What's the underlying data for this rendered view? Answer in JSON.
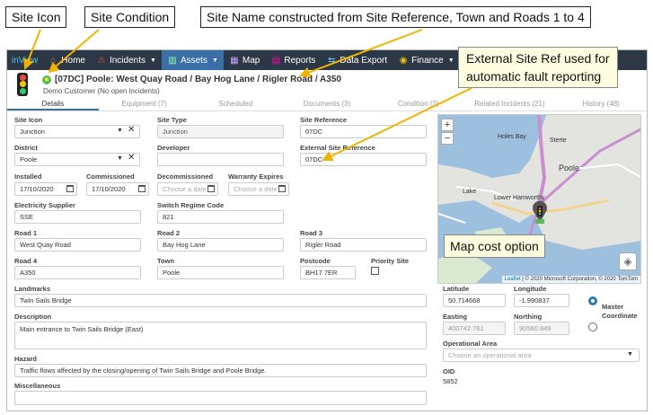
{
  "callouts": {
    "site_icon": "Site Icon",
    "site_condition": "Site Condition",
    "site_name_note": "Site Name constructed from Site Reference, Town and Roads 1 to 4",
    "external_ref_note_1": "External Site Ref used for",
    "external_ref_note_2": "automatic fault reporting",
    "map_cost": "Map cost option"
  },
  "nav": {
    "brand": "inView",
    "items": [
      {
        "label": "Home",
        "icon": "home-icon"
      },
      {
        "label": "Incidents",
        "icon": "warning-icon",
        "caret": true
      },
      {
        "label": "Assets",
        "icon": "assets-icon",
        "caret": true,
        "active": true
      },
      {
        "label": "Map",
        "icon": "map-icon"
      },
      {
        "label": "Reports",
        "icon": "reports-icon"
      },
      {
        "label": "Data Export",
        "icon": "data-export-icon"
      },
      {
        "label": "Finance",
        "icon": "finance-icon",
        "caret": true
      }
    ]
  },
  "header": {
    "title": "[07DC] Poole: West Quay Road / Bay Hog Lane / Rigler Road / A350",
    "subtitle": "Demo Customer  (No open incidents)"
  },
  "tabs": [
    "Details",
    "Equipment (7)",
    "Scheduled",
    "Documents (3)",
    "Condition (2)",
    "Related Incidents (21)",
    "History (48)"
  ],
  "form": {
    "site_icon": {
      "label": "Site Icon",
      "value": "Junction"
    },
    "site_type": {
      "label": "Site Type",
      "value": "Junction"
    },
    "site_reference": {
      "label": "Site Reference",
      "value": "07DC"
    },
    "district": {
      "label": "District",
      "value": "Poole"
    },
    "developer": {
      "label": "Developer",
      "value": ""
    },
    "external_site_reference": {
      "label": "External Site Reference",
      "value": "07DC"
    },
    "installed": {
      "label": "Installed",
      "value": "17/10/2020"
    },
    "commissioned": {
      "label": "Commissioned",
      "value": "17/10/2020"
    },
    "decommissioned": {
      "label": "Decommissioned",
      "placeholder": "Choose a date"
    },
    "warranty_expires": {
      "label": "Warranty Expires",
      "placeholder": "Choose a date"
    },
    "electricity_supplier": {
      "label": "Electricity Supplier",
      "value": "SSE"
    },
    "switch_regime_code": {
      "label": "Switch Regime Code",
      "value": "821"
    },
    "road1": {
      "label": "Road 1",
      "value": "West Quay Road"
    },
    "road2": {
      "label": "Road 2",
      "value": "Bay Hog Lane"
    },
    "road3": {
      "label": "Road 3",
      "value": "Rigler Road"
    },
    "road4": {
      "label": "Road 4",
      "value": "A350"
    },
    "town": {
      "label": "Town",
      "value": "Poole"
    },
    "postcode": {
      "label": "Postcode",
      "value": "BH17 7ER"
    },
    "priority_site": {
      "label": "Priority Site"
    },
    "landmarks": {
      "label": "Landmarks",
      "value": "Twin Sails Bridge"
    },
    "description": {
      "label": "Description",
      "value": "Main entrance to Twin Sails Bridge (East)"
    },
    "hazard": {
      "label": "Hazard",
      "value": "Traffic flows affected by the closing/opening of Twin Sails Bridge and Poole Bridge."
    },
    "miscellaneous": {
      "label": "Miscellaneous",
      "value": ""
    }
  },
  "coords": {
    "latitude": {
      "label": "Latitude",
      "value": "50.714668"
    },
    "longitude": {
      "label": "Longitude",
      "value": "-1.990837"
    },
    "master_coordinate": "Master Coordinate",
    "easting": {
      "label": "Easting",
      "value": "400742.761"
    },
    "northing": {
      "label": "Northing",
      "value": "90560.849"
    },
    "operational_area": {
      "label": "Operational Area",
      "placeholder": "Choose an operational area"
    },
    "oid": {
      "label": "OID",
      "value": "5852"
    }
  },
  "map": {
    "labels": {
      "holes_bay": "Holes Bay",
      "sterte": "Sterte",
      "poole": "Poole",
      "lake": "Lake",
      "lower_hamworthy": "Lower Hamworthy",
      "hamworthy": "Hamworthy"
    },
    "attribution_leaflet": "Leaflet",
    "attribution_rest": " | © 2020 Microsoft Corporation, © 2020 TomTom",
    "zoom_in": "+",
    "zoom_out": "−"
  },
  "colors": {
    "navbar": "#2d3846",
    "active_tab": "#3a6fa8",
    "accent": "#2a7ab8"
  }
}
